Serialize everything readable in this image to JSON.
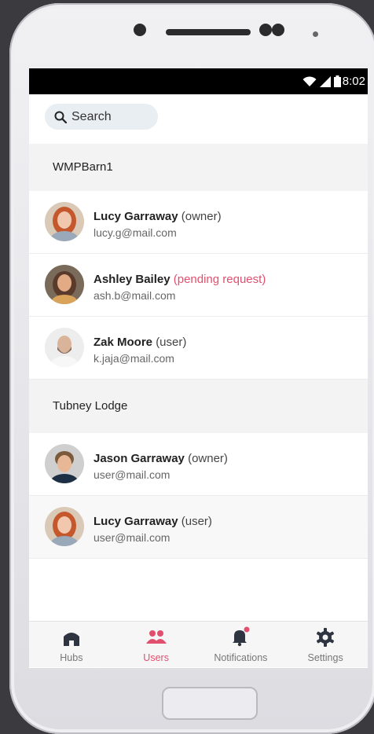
{
  "status_bar": {
    "time": "8:02"
  },
  "search": {
    "placeholder": "Search"
  },
  "groups": [
    {
      "name": "WMPBarn1",
      "users": [
        {
          "name": "Lucy Garraway",
          "role": "(owner)",
          "email": "lucy.g@mail.com",
          "pending": false
        },
        {
          "name": "Ashley Bailey",
          "role": "(pending request)",
          "email": "ash.b@mail.com",
          "pending": true
        },
        {
          "name": "Zak Moore",
          "role": "(user)",
          "email": "k.jaja@mail.com",
          "pending": false
        }
      ]
    },
    {
      "name": "Tubney Lodge",
      "users": [
        {
          "name": "Jason Garraway",
          "role": "(owner)",
          "email": "user@mail.com",
          "pending": false
        },
        {
          "name": "Lucy Garraway",
          "role": "(user)",
          "email": "user@mail.com",
          "pending": false
        }
      ]
    }
  ],
  "tabs": [
    {
      "label": "Hubs",
      "icon": "home-icon",
      "active": false
    },
    {
      "label": "Users",
      "icon": "users-icon",
      "active": true
    },
    {
      "label": "Notifications",
      "icon": "bell-icon",
      "active": false
    },
    {
      "label": "Settings",
      "icon": "gear-icon",
      "active": false
    }
  ],
  "colors": {
    "accent": "#e0506e",
    "dark_icon": "#2e3440"
  }
}
